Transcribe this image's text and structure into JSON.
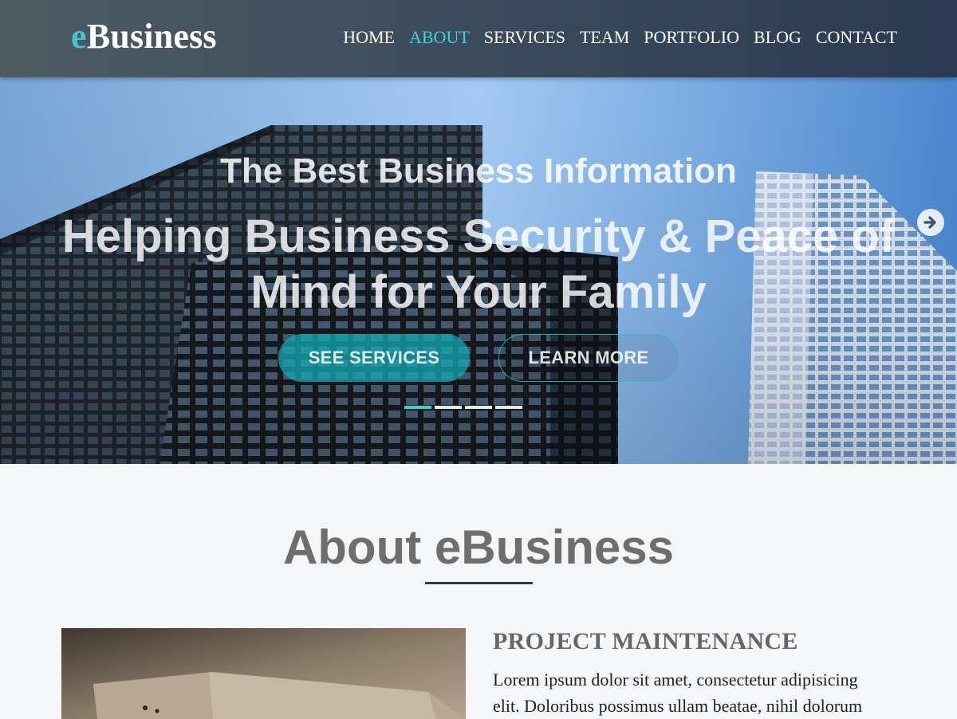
{
  "header": {
    "logo_accent": "e",
    "logo_rest": "Business",
    "nav": [
      {
        "label": "HOME"
      },
      {
        "label": "ABOUT"
      },
      {
        "label": "SERVICES"
      },
      {
        "label": "TEAM"
      },
      {
        "label": "PORTFOLIO"
      },
      {
        "label": "BLOG"
      },
      {
        "label": "CONTACT"
      }
    ],
    "active_index": 1
  },
  "hero": {
    "subtitle": "The Best Business Information",
    "title": "Helping Business Security & Peace of Mind for Your Family",
    "primary_button": "SEE SERVICES",
    "secondary_button": "LEARN MORE",
    "slide_count": 4,
    "active_slide": 1,
    "next_icon": "arrow-right-icon"
  },
  "about": {
    "title": "About eBusiness",
    "heading": "PROJECT MAINTENANCE",
    "text": "Lorem ipsum dolor sit amet, consectetur adipisicing elit. Doloribus possimus ullam beatae, nihil dolorum"
  },
  "colors": {
    "accent": "#3fd0dc",
    "header_bg": "#3f4f5f",
    "primary_button": "#14aab4"
  }
}
